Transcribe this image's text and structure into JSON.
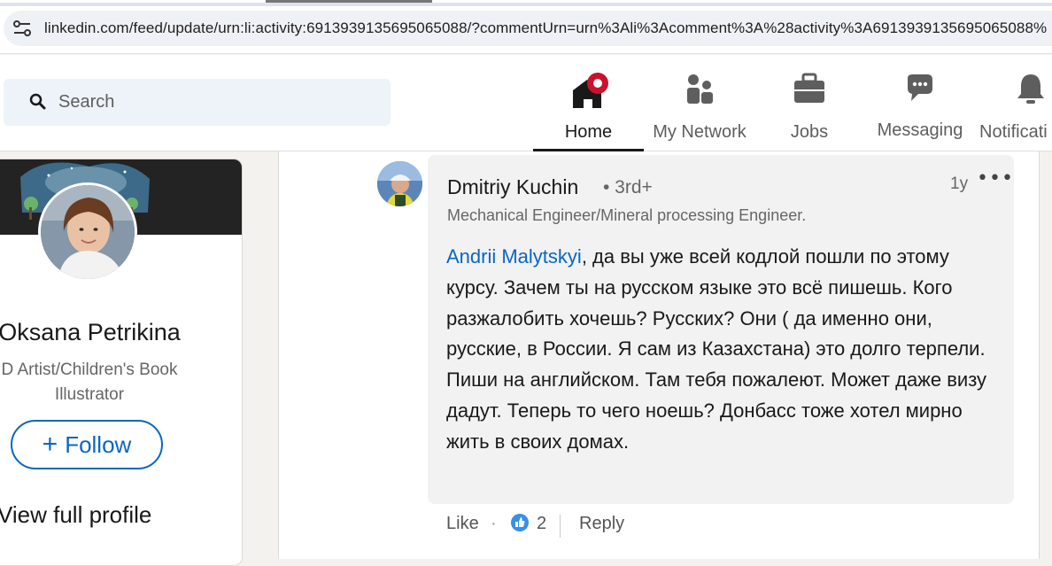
{
  "browser": {
    "url": "linkedin.com/feed/update/urn:li:activity:6913939135695065088/?commentUrn=urn%3Ali%3Acomment%3A%28activity%3A6913939135695065088%"
  },
  "nav": {
    "search_placeholder": "Search",
    "items": [
      {
        "label": "Home",
        "icon": "home-icon",
        "active": true
      },
      {
        "label": "My Network",
        "icon": "people-icon",
        "active": false
      },
      {
        "label": "Jobs",
        "icon": "briefcase-icon",
        "active": false
      },
      {
        "label": "Messaging",
        "icon": "chat-icon",
        "active": false
      },
      {
        "label": "Notificati",
        "icon": "bell-icon",
        "active": false
      }
    ]
  },
  "profile": {
    "name": "Oksana Petrikina",
    "title_line1": "D Artist/Children's Book",
    "title_line2": "Illustrator",
    "follow_label": "Follow",
    "view_profile": "View full profile"
  },
  "comment": {
    "author": "Dmitriy Kuchin",
    "degree": "• 3rd+",
    "time": "1y",
    "more": "•••",
    "headline": "Mechanical Engineer/Mineral processing Engineer.",
    "mention": "Andrii Malytskyi",
    "text": ", да вы уже всей кодлой пошли по этому курсу. Зачем ты на русском языке это всё пишешь. Кого разжалобить хочешь? Русских? Они ( да именно они, русские, в России. Я сам из Казахстана) это долго терпели. Пиши на английском. Там тебя пожалеют. Может даже визу дадут. Теперь то чего ноешь? Донбасс тоже хотел мирно жить в своих домах.",
    "like_label": "Like",
    "reactions_count": "2",
    "reply_label": "Reply"
  },
  "colors": {
    "accent": "#0a66c2",
    "notification": "#cb112d"
  }
}
